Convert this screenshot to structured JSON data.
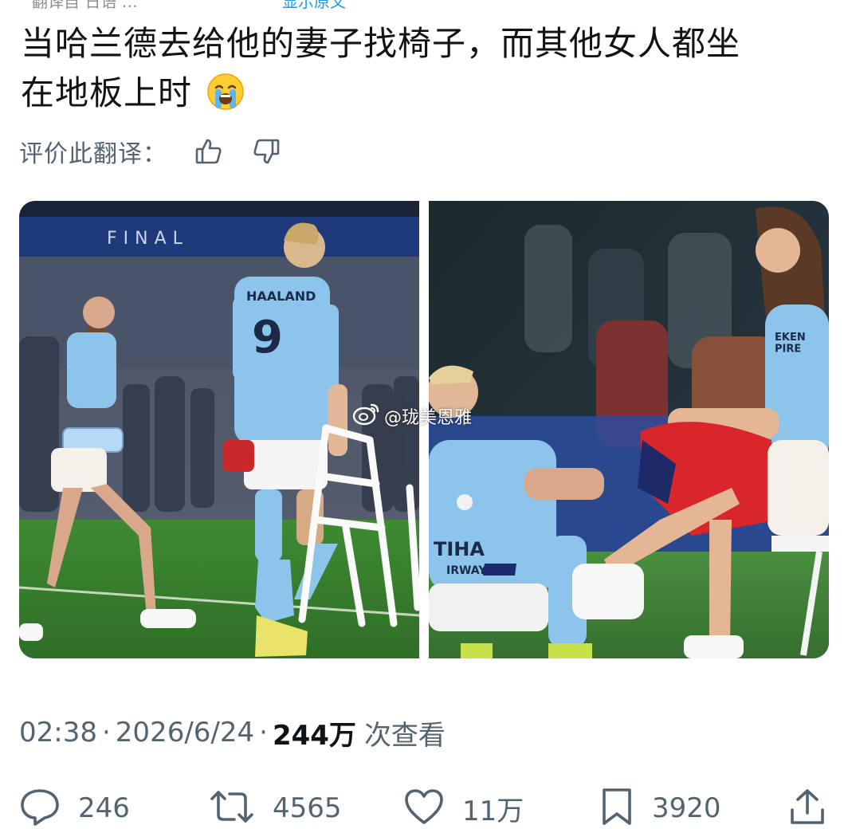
{
  "tweet": {
    "text_line1": "当哈兰德去给他的妻子找椅子，而其他女人都坐",
    "text_line2": "在地板上时",
    "emoji": "loudly-crying-face"
  },
  "translation_rating": {
    "label": "评价此翻译：",
    "like_icon": "thumbs-up-icon",
    "dislike_icon": "thumbs-down-icon"
  },
  "media": {
    "left_photo": {
      "banner_text": "FINAL",
      "jersey_name": "HAALAND",
      "jersey_number": "9"
    },
    "right_photo": {
      "jersey_text": "TIHA",
      "jersey_text2": "IRWAYS",
      "shirt_text": "EKEN\nPIRE"
    },
    "watermark": "@珑美恩雅"
  },
  "meta": {
    "time": "02:38",
    "date": "2026/6/24",
    "views_count": "244万",
    "views_label": "次查看",
    "separator": "·"
  },
  "actions": {
    "reply_count": "246",
    "retweet_count": "4565",
    "like_count": "11万",
    "bookmark_count": "3920"
  },
  "colors": {
    "text_primary": "#0f1419",
    "text_secondary": "#536471",
    "accent": "#1d9bf0"
  }
}
